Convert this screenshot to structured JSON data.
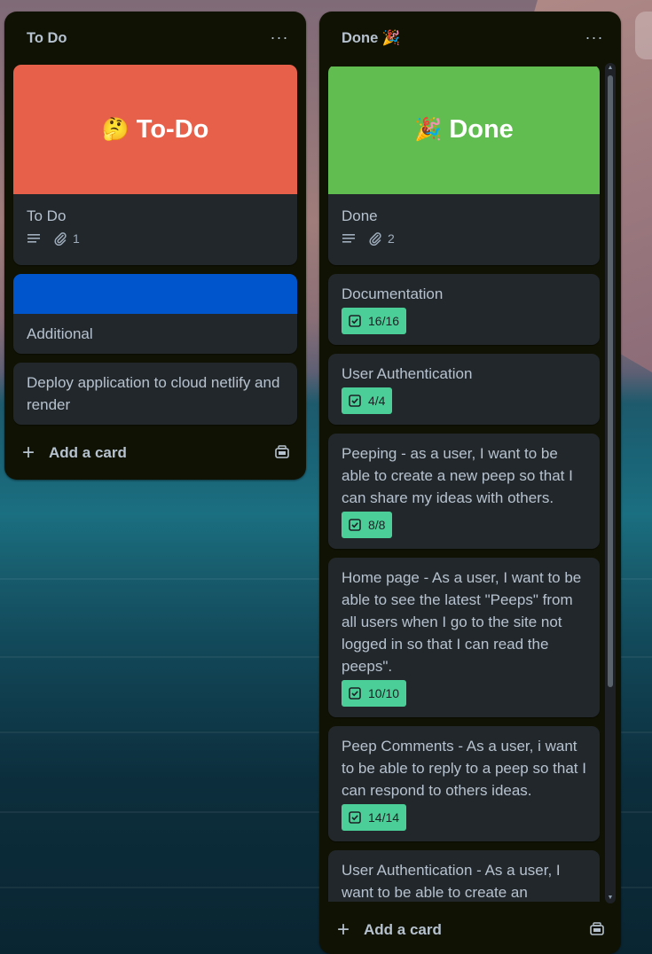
{
  "lists": [
    {
      "title": "To Do",
      "menu_label": "···",
      "cards": [
        {
          "cover_emoji": "🤔",
          "cover_text": "To-Do",
          "cover_color": "#e7604a",
          "title": "To Do",
          "attachments": "1"
        },
        {
          "cover_color": "#0055cc",
          "title": "Additional"
        },
        {
          "title": "Deploy application to cloud netlify and render"
        }
      ],
      "add_card_label": "Add a card"
    },
    {
      "title": "Done 🎉",
      "menu_label": "···",
      "cards": [
        {
          "cover_emoji": "🎉",
          "cover_text": "Done",
          "cover_color": "#61bd4f",
          "title": "Done",
          "attachments": "2"
        },
        {
          "title": "Documentation",
          "checklist": "16/16"
        },
        {
          "title": "User Authentication",
          "checklist": "4/4"
        },
        {
          "title": "Peeping - as a user, I want to be able to create a new peep so that I can share my ideas with others.",
          "checklist": "8/8"
        },
        {
          "title": "Home page - As a user, I want to be able to see the latest \"Peeps\" from all users when I go to the site not logged in so that I can read the peeps\".",
          "checklist": "10/10"
        },
        {
          "title": "Peep Comments - As a user, i want to be able to reply to a peep so that I can respond to others ideas.",
          "checklist": "14/14"
        },
        {
          "title": "User Authentication - As a user, I want to be able to create an"
        }
      ],
      "add_card_label": "Add a card"
    }
  ],
  "colors": {
    "list_bg": "#101204",
    "card_bg": "#22272b",
    "text": "#b6c2cf",
    "checklist_complete": "#4bce97"
  }
}
